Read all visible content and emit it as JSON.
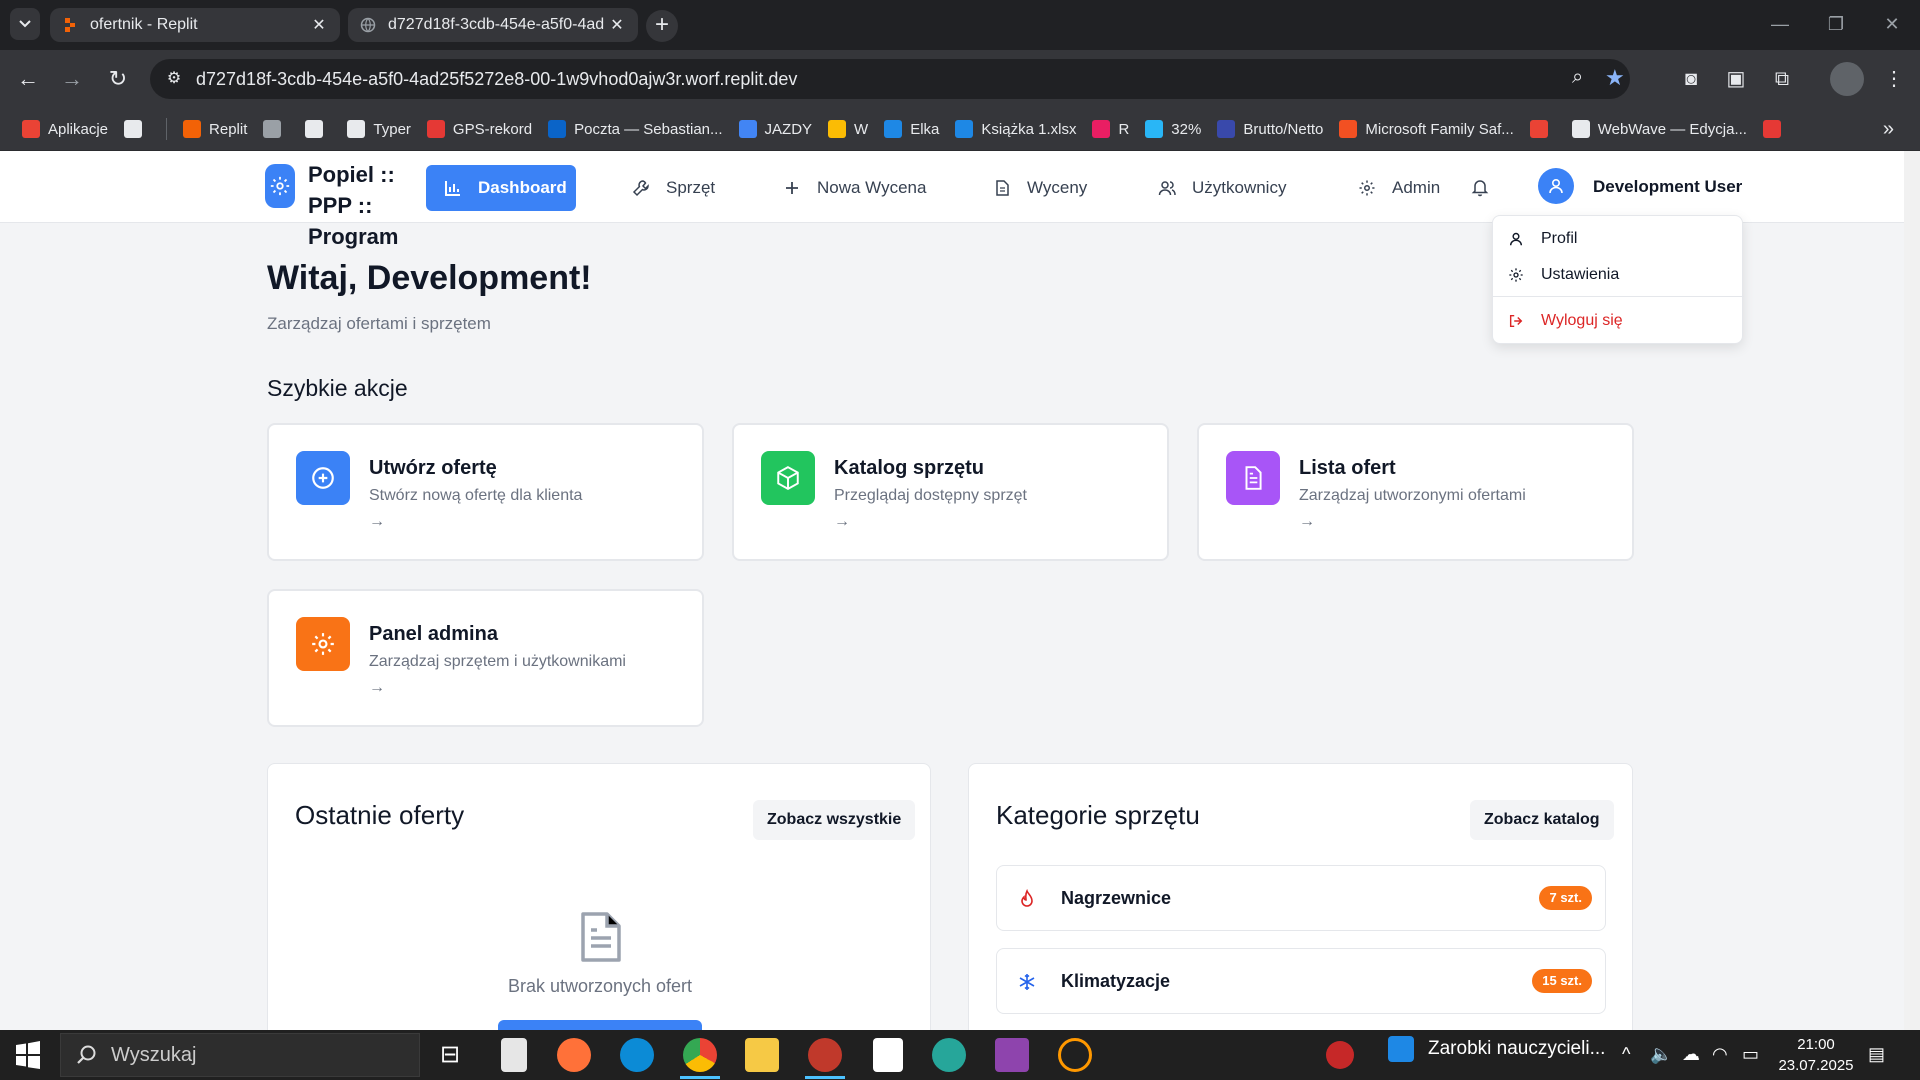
{
  "browser": {
    "tabs": [
      {
        "title": "ofertnik - Replit",
        "favicon": "replit-icon"
      },
      {
        "title": "d727d18f-3cdb-454e-a5f0-4ad",
        "favicon": "globe-icon"
      }
    ],
    "url": "d727d18f-3cdb-454e-a5f0-4ad25f5272e8-00-1w9vhod0ajw3r.worf.replit.dev",
    "bookmarks": [
      {
        "label": "Aplikacje",
        "icon": "apps-grid-icon",
        "color": "#ea4335"
      },
      {
        "label": "",
        "icon": "grid-icon",
        "color": "#e8eaed"
      },
      {
        "label": "Replit",
        "icon": "replit-icon",
        "color": "#f26207"
      },
      {
        "label": "",
        "icon": "globe-icon",
        "color": "#9aa0a6"
      },
      {
        "label": "",
        "icon": "openai-icon",
        "color": "#e8eaed"
      },
      {
        "label": "Typer",
        "icon": "folder-icon",
        "color": "#e8eaed"
      },
      {
        "label": "GPS-rekord",
        "icon": "gps-icon",
        "color": "#e53935"
      },
      {
        "label": "Poczta — Sebastian...",
        "icon": "outlook-icon",
        "color": "#0a64c8"
      },
      {
        "label": "JAZDY",
        "icon": "calendar-icon",
        "color": "#4285f4"
      },
      {
        "label": "W",
        "icon": "chrome-icon",
        "color": "#fbbc04"
      },
      {
        "label": "Elka",
        "icon": "onedrive-icon",
        "color": "#1e88e5"
      },
      {
        "label": "Książka 1.xlsx",
        "icon": "onedrive-icon",
        "color": "#1e88e5"
      },
      {
        "label": "R",
        "icon": "x-icon",
        "color": "#e91e63"
      },
      {
        "label": "32%",
        "icon": "tag-icon",
        "color": "#29b6f6"
      },
      {
        "label": "Brutto/Netto",
        "icon": "p-icon",
        "color": "#3949ab"
      },
      {
        "label": "Microsoft Family Saf...",
        "icon": "microsoft-icon",
        "color": "#f25022"
      },
      {
        "label": "",
        "icon": "gmail-icon",
        "color": "#ea4335"
      },
      {
        "label": "WebWave — Edycja...",
        "icon": "webwave-icon",
        "color": "#e8eaed"
      },
      {
        "label": "",
        "icon": "z-icon",
        "color": "#e53935"
      }
    ]
  },
  "app": {
    "logo_text": "Popiel :: PPP :: Program",
    "nav": [
      {
        "label": "Dashboard",
        "icon": "chart-icon",
        "active": true
      },
      {
        "label": "Sprzęt",
        "icon": "wrench-icon",
        "active": false
      },
      {
        "label": "Nowa Wycena",
        "icon": "plus-icon",
        "active": false
      },
      {
        "label": "Wyceny",
        "icon": "file-icon",
        "active": false
      },
      {
        "label": "Użytkownicy",
        "icon": "users-icon",
        "active": false
      },
      {
        "label": "Admin",
        "icon": "gear-icon",
        "active": false
      }
    ],
    "user_name": "Development User",
    "user_menu": {
      "items": [
        {
          "label": "Profil",
          "icon": "user-icon"
        },
        {
          "label": "Ustawienia",
          "icon": "gear-icon"
        }
      ],
      "logout": {
        "label": "Wyloguj się",
        "icon": "logout-icon"
      }
    },
    "welcome_title": "Witaj, Development!",
    "welcome_subtitle": "Zarządzaj ofertami i sprzętem",
    "quick_actions_title": "Szybkie akcje",
    "quick_actions": [
      {
        "title": "Utwórz ofertę",
        "desc": "Stwórz nową ofertę dla klienta",
        "icon": "plus-circle-icon",
        "color": "#3b82f6"
      },
      {
        "title": "Katalog sprzętu",
        "desc": "Przeglądaj dostępny sprzęt",
        "icon": "package-icon",
        "color": "#22c55e"
      },
      {
        "title": "Lista ofert",
        "desc": "Zarządzaj utworzonymi ofertami",
        "icon": "document-icon",
        "color": "#a855f7"
      },
      {
        "title": "Panel admina",
        "desc": "Zarządzaj sprzętem i użytkownikami",
        "icon": "gear-icon",
        "color": "#f97316"
      }
    ],
    "recent_offers": {
      "title": "Ostatnie oferty",
      "button": "Zobacz wszystkie",
      "empty_text": "Brak utworzonych ofert"
    },
    "categories": {
      "title": "Kategorie sprzętu",
      "button": "Zobacz katalog",
      "items": [
        {
          "name": "Nagrzewnice",
          "count": "7 szt.",
          "icon": "flame-icon",
          "color": "#dc2626"
        },
        {
          "name": "Klimatyzacje",
          "count": "15 szt.",
          "icon": "snowflake-icon",
          "color": "#2563eb"
        }
      ]
    }
  },
  "taskbar": {
    "search_placeholder": "Wyszukaj",
    "widget_label": "Zarobki nauczycieli...",
    "time": "21:00",
    "date": "23.07.2025"
  },
  "colors": {
    "primary": "#3b82f6",
    "danger": "#dc2626",
    "badge": "#f97316"
  }
}
